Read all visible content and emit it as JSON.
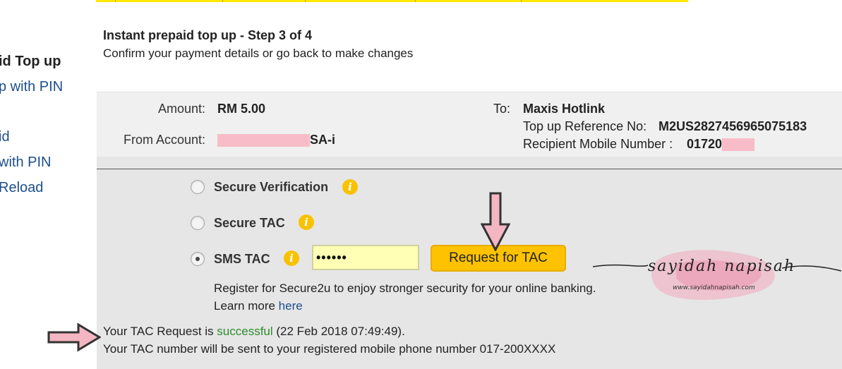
{
  "sidebar": {
    "items": [
      {
        "label": "id Top up",
        "bold": true
      },
      {
        "label": "p with PIN",
        "bold": false
      },
      {
        "label": "id",
        "bold": false
      },
      {
        "label": "with PIN",
        "bold": false
      },
      {
        "label": "Reload",
        "bold": false
      }
    ]
  },
  "header": {
    "title": "Instant prepaid top up - Step 3 of 4",
    "subtitle": "Confirm your payment details or go back to make changes"
  },
  "details": {
    "amount_label": "Amount:",
    "amount_value": "RM 5.00",
    "from_label": "From Account:",
    "from_value_suffix": "SA-i",
    "to_label": "To:",
    "to_value": "Maxis Hotlink",
    "ref_label": "Top up Reference No:",
    "ref_value": "M2US2827456965075183",
    "recipient_label": "Recipient Mobile Number :",
    "recipient_value": "01720"
  },
  "auth": {
    "options": [
      {
        "label": "Secure Verification",
        "selected": false
      },
      {
        "label": "Secure TAC",
        "selected": false
      },
      {
        "label": "SMS TAC",
        "selected": true
      }
    ],
    "tac_value": "••••••",
    "request_button": "Request for TAC",
    "register_text": "Register for Secure2u to enjoy stronger security for your online banking.",
    "learn_more_text": "Learn more",
    "learn_more_link": "here"
  },
  "messages": {
    "line1_prefix": "Your TAC Request is",
    "line1_status": "successful",
    "line1_suffix": "(22 Feb 2018 07:49:49).",
    "line2": "Your TAC number will be sent to your registered mobile phone number 017-200XXXX"
  },
  "watermark": {
    "text": "sayidah napisah",
    "url": "www.sayidahnapisah.com"
  },
  "colors": {
    "accent_yellow": "#fec200",
    "link_blue": "#1d4f8c",
    "success_green": "#2e8b2e",
    "redaction_pink": "#f8bcc8",
    "annotation_arrow": "#f4b6c2"
  },
  "icons": [
    "info-icon",
    "down-arrow-annotation",
    "right-arrow-annotation"
  ]
}
